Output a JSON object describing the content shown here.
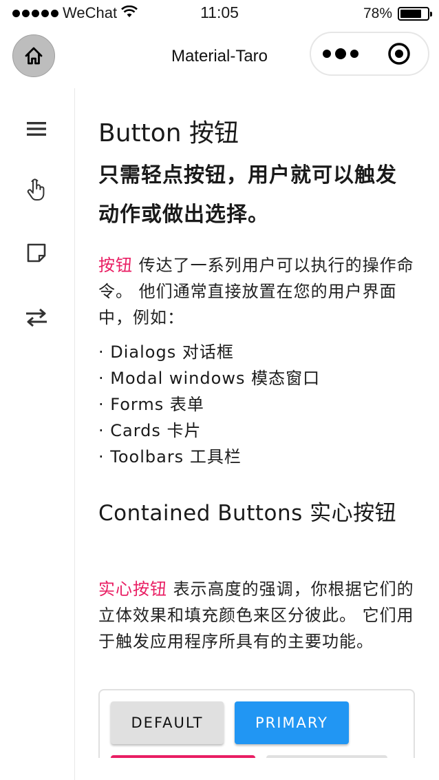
{
  "status_bar": {
    "carrier": "WeChat",
    "time": "11:05",
    "battery_percent": "78%",
    "battery_level": 0.78
  },
  "nav_bar": {
    "title": "Material-Taro"
  },
  "sidebar": {
    "items": [
      {
        "icon": "menu-icon"
      },
      {
        "icon": "touch-icon"
      },
      {
        "icon": "note-icon"
      },
      {
        "icon": "swap-icon"
      }
    ]
  },
  "content": {
    "title": "Button 按钮",
    "subtitle": "只需轻点按钮，用户就可以触发动作或做出选择。",
    "intro": {
      "link": "按钮",
      "text": " 传达了一系列用户可以执行的操作命令。 他们通常直接放置在您的用户界面中，例如："
    },
    "list": [
      "· Dialogs 对话框",
      "· Modal windows 模态窗口",
      "· Forms 表单",
      "· Cards 卡片",
      "· Toolbars 工具栏"
    ],
    "section": {
      "title": "Contained Buttons 实心按钮",
      "link": "实心按钮",
      "text": " 表示高度的强调，你根据它们的立体效果和填充颜色来区分彼此。 它们用于触发应用程序所具有的主要功能。"
    },
    "demo_buttons": {
      "default": "DEFAULT",
      "primary": "PRIMARY"
    }
  },
  "colors": {
    "accent": "#e91e63",
    "primary": "#2196f3",
    "default_button": "#e0e0e0"
  }
}
